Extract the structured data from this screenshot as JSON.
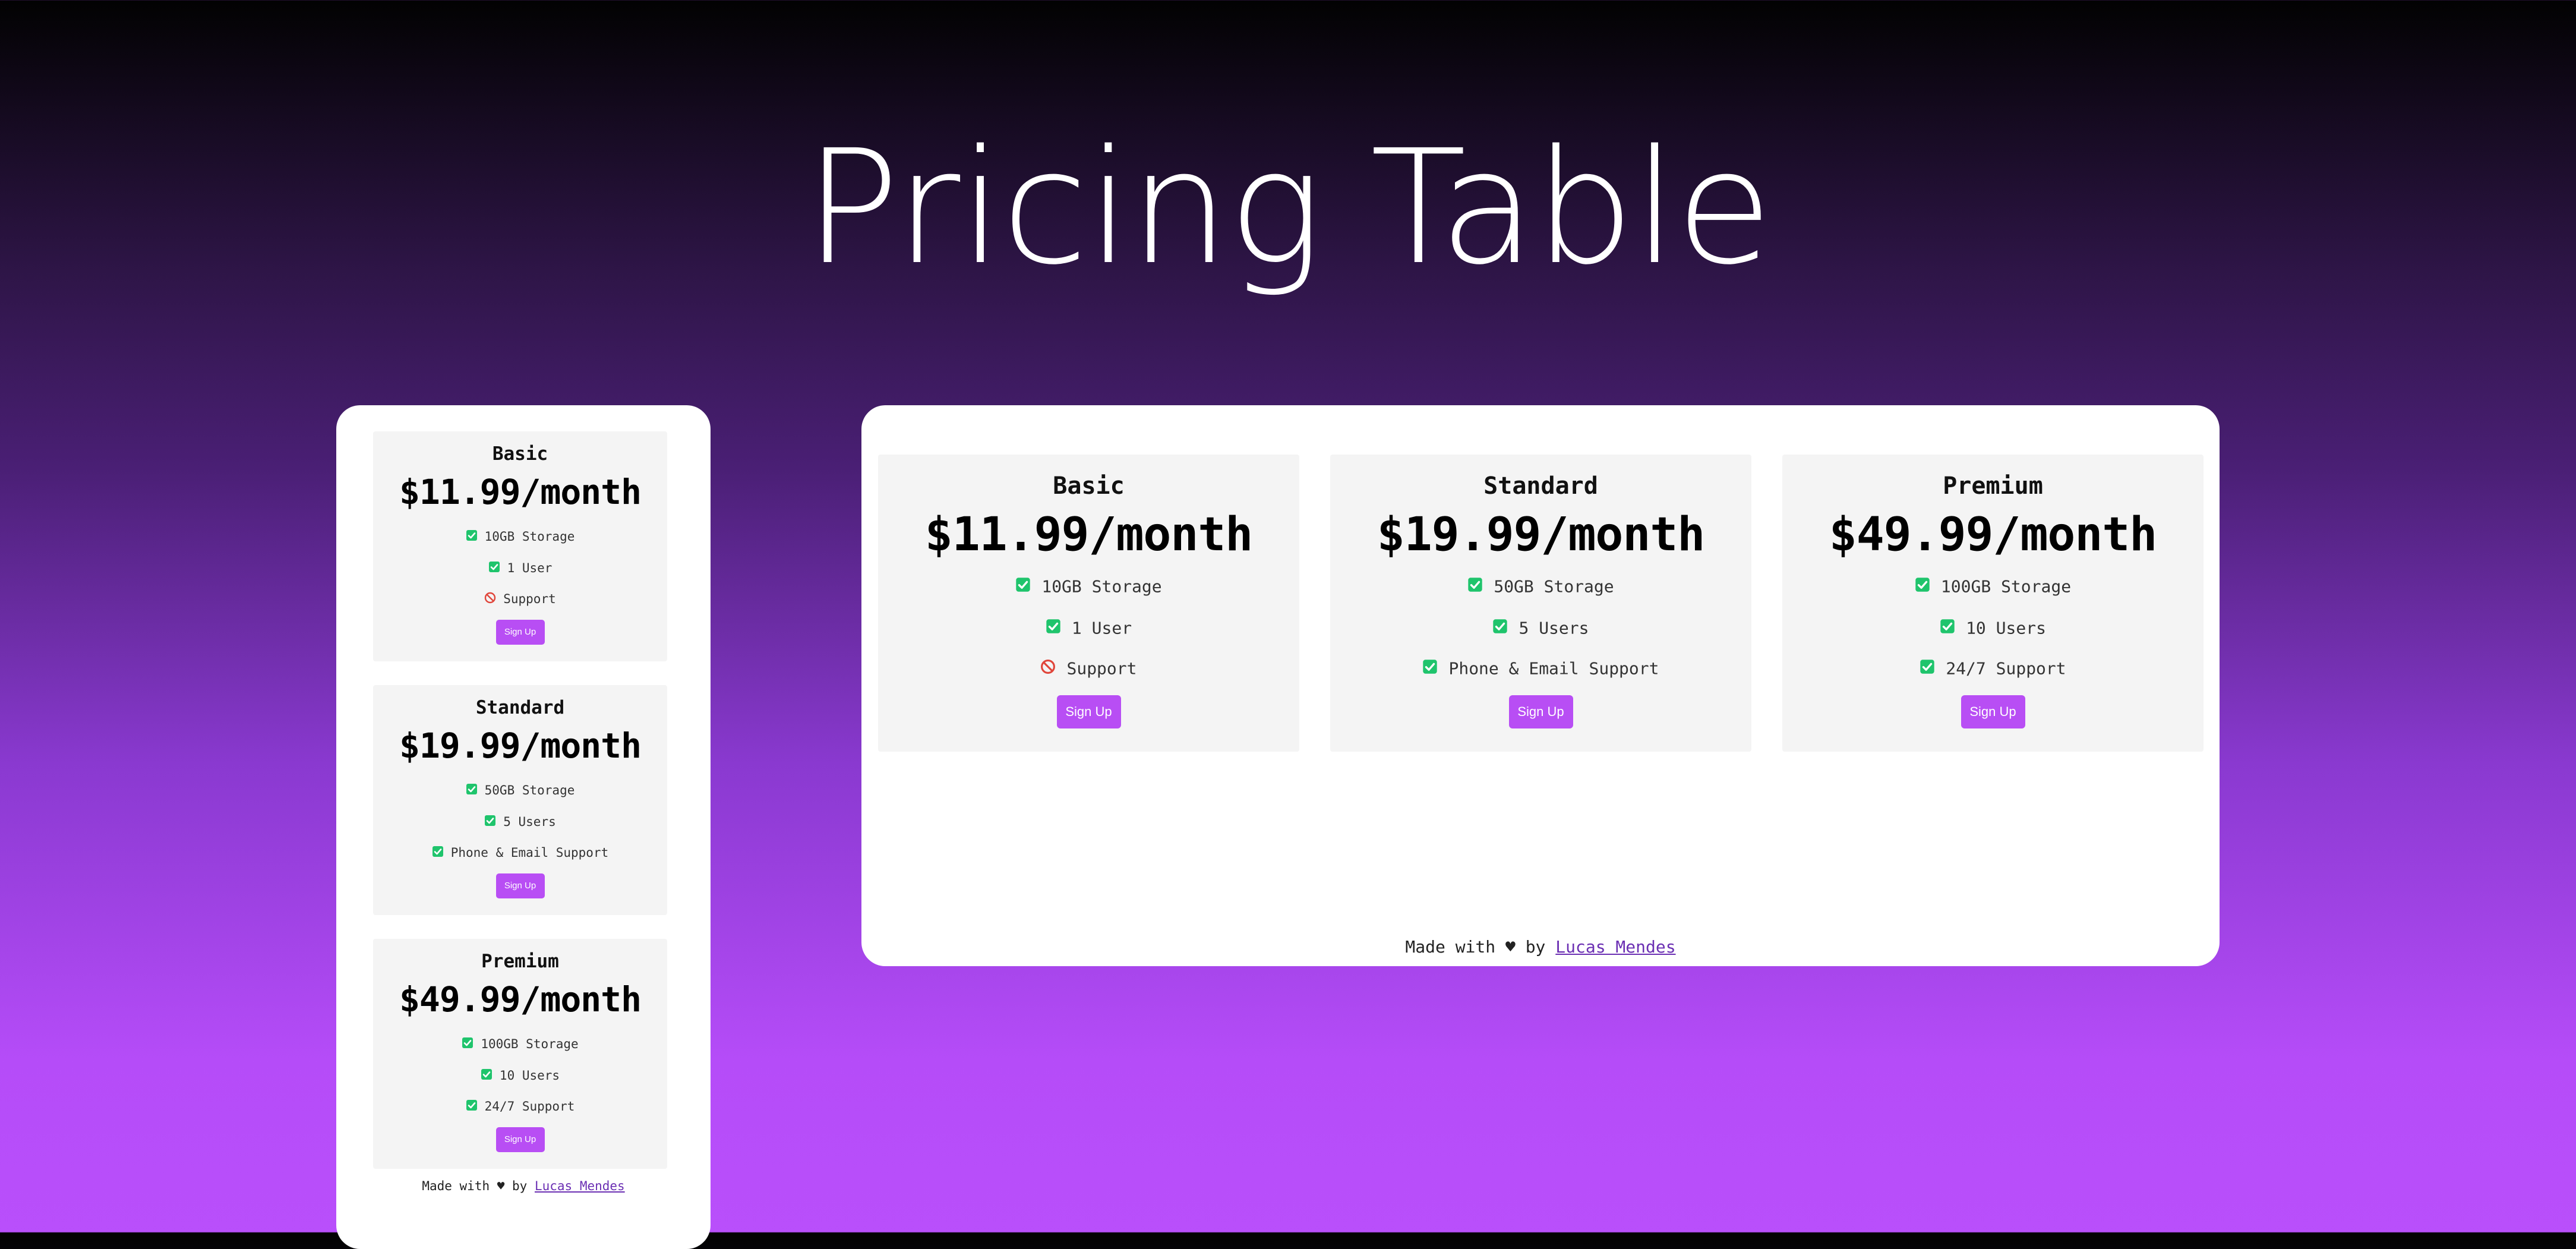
{
  "page": {
    "title": "Pricing Table"
  },
  "colors": {
    "accent": "#b84ef4",
    "check": "#1fc46c",
    "blocked": "#e0453a"
  },
  "plans": [
    {
      "name": "Basic",
      "price": "$11.99/month",
      "features": [
        {
          "label": "10GB Storage",
          "icon": "check-icon"
        },
        {
          "label": "1 User",
          "icon": "check-icon"
        },
        {
          "label": "Support",
          "icon": "blocked-icon"
        }
      ],
      "button": "Sign Up"
    },
    {
      "name": "Standard",
      "price": "$19.99/month",
      "features": [
        {
          "label": "50GB Storage",
          "icon": "check-icon"
        },
        {
          "label": "5 Users",
          "icon": "check-icon"
        },
        {
          "label": "Phone & Email Support",
          "icon": "check-icon"
        }
      ],
      "button": "Sign Up"
    },
    {
      "name": "Premium",
      "price": "$49.99/month",
      "features": [
        {
          "label": "100GB Storage",
          "icon": "check-icon"
        },
        {
          "label": "10 Users",
          "icon": "check-icon"
        },
        {
          "label": "24/7 Support",
          "icon": "check-icon"
        }
      ],
      "button": "Sign Up"
    }
  ],
  "footer": {
    "prefix": "Made with ♥ by ",
    "author": "Lucas Mendes"
  }
}
